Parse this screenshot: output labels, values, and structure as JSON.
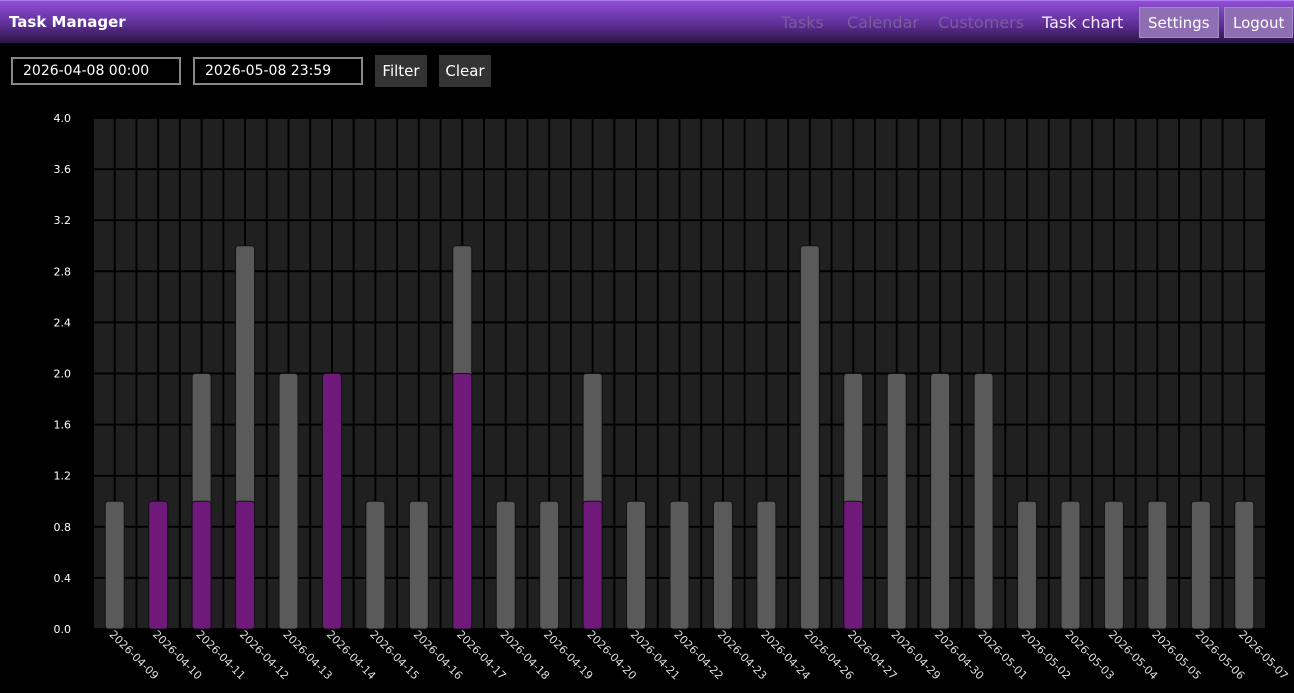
{
  "app": {
    "title": "Task Manager"
  },
  "nav": {
    "tasks": "Tasks",
    "calendar": "Calendar",
    "customers": "Customers",
    "task_chart": "Task chart",
    "settings": "Settings",
    "logout": "Logout"
  },
  "filters": {
    "from": "2026-04-08 00:00",
    "to": "2026-05-08 23:59",
    "filter_label": "Filter",
    "clear_label": "Clear"
  },
  "colors": {
    "highlight": "#6f1a7b",
    "base": "#5a5a5a",
    "plot_bg": "#202020"
  },
  "chart_data": {
    "type": "bar",
    "categories": [
      "2026-04-09",
      "2026-04-10",
      "2026-04-11",
      "2026-04-12",
      "2026-04-13",
      "2026-04-14",
      "2026-04-15",
      "2026-04-16",
      "2026-04-17",
      "2026-04-18",
      "2026-04-19",
      "2026-04-20",
      "2026-04-21",
      "2026-04-22",
      "2026-04-23",
      "2026-04-24",
      "2026-04-26",
      "2026-04-27",
      "2026-04-29",
      "2026-04-30",
      "2026-05-01",
      "2026-05-02",
      "2026-05-03",
      "2026-05-04",
      "2026-05-05",
      "2026-05-06",
      "2026-05-07"
    ],
    "series": [
      {
        "values": [
          1,
          0,
          1,
          2,
          2,
          0,
          1,
          1,
          1,
          1,
          1,
          1,
          1,
          1,
          1,
          1,
          3,
          1,
          2,
          2,
          2,
          1,
          1,
          1,
          1,
          1,
          1
        ]
      },
      {
        "values": [
          0,
          1,
          1,
          1,
          0,
          2,
          0,
          0,
          2,
          0,
          0,
          1,
          0,
          0,
          0,
          0,
          0,
          1,
          0,
          0,
          0,
          0,
          0,
          0,
          0,
          0,
          0
        ]
      }
    ],
    "ylim": [
      0,
      4.0
    ],
    "yticks": [
      "0.0",
      "0.4",
      "0.8",
      "1.2",
      "1.6",
      "2.0",
      "2.4",
      "2.8",
      "3.2",
      "3.6",
      "4.0"
    ],
    "grid": true
  }
}
